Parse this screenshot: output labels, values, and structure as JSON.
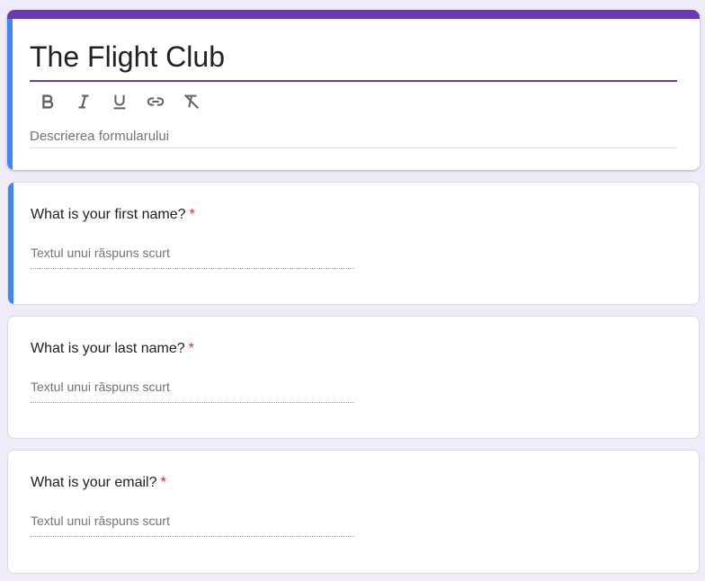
{
  "form": {
    "title": "The Flight Club",
    "description_placeholder": "Descrierea formularului"
  },
  "toolbar": {
    "items": [
      "bold-icon",
      "italic-icon",
      "underline-icon",
      "link-icon",
      "clear-format-icon"
    ]
  },
  "questions": [
    {
      "title": "What is your first name?",
      "required_mark": "*",
      "answer_placeholder": "Textul unui răspuns scurt",
      "active": true
    },
    {
      "title": "What is your last name?",
      "required_mark": "*",
      "answer_placeholder": "Textul unui răspuns scurt",
      "active": false
    },
    {
      "title": "What is your email?",
      "required_mark": "*",
      "answer_placeholder": "Textul unui răspuns scurt",
      "active": false
    }
  ],
  "colors": {
    "theme": "#673ab7",
    "active_accent": "#4285f4",
    "background": "#f0ebf8",
    "required": "#d93025"
  }
}
